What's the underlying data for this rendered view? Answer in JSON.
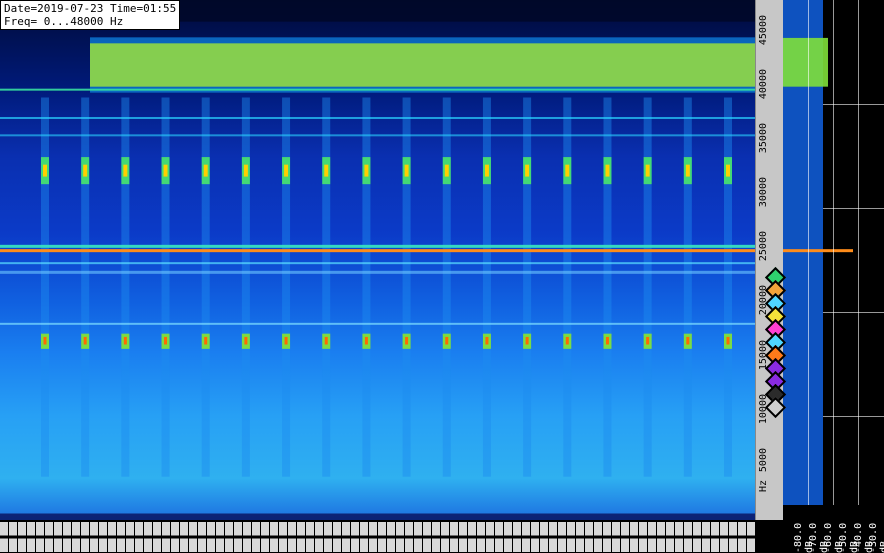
{
  "status": {
    "line1": "Date=2019-07-23 Time=01:55",
    "line2": "Freq= 0...48000 Hz"
  },
  "chart_data": {
    "type": "heatmap",
    "title": "",
    "xlabel": "",
    "ylabel": "Hz",
    "ylim": [
      0,
      48000
    ],
    "y_tick_labels": [
      "45000",
      "40000",
      "35000",
      "30000",
      "25000",
      "20000",
      "15000",
      "10000",
      "5000",
      "Hz"
    ],
    "y_tick_values": [
      45000,
      40000,
      35000,
      30000,
      25000,
      20000,
      15000,
      10000,
      5000,
      0
    ],
    "level_axis_labels": [
      "-80.0 dB",
      "-70.0 dB",
      "-60.0 dB",
      "-50.0 dB",
      "-40.0 dB",
      "-30.0 dB"
    ],
    "level_axis_values": [
      -80,
      -70,
      -60,
      -50,
      -40,
      -30
    ],
    "colors": {
      "background_low": "#001a7a",
      "background_high": "#27a0f5",
      "band_signal": "#9be13c",
      "burst_hot": "#ffd000",
      "carrier_line": "#ff8c1a"
    },
    "pulse_count": 18,
    "carrier_freq_hz": 25000,
    "top_band_hz": [
      40000,
      44000
    ]
  },
  "markers": [
    {
      "color": "#2ed16e"
    },
    {
      "color": "#f2a33a"
    },
    {
      "color": "#4fd6ff"
    },
    {
      "color": "#f5e23a"
    },
    {
      "color": "#ff3fd2"
    },
    {
      "color": "#4fd6ff"
    },
    {
      "color": "#ff7a1a"
    },
    {
      "color": "#8a2be2"
    },
    {
      "color": "#8a2be2"
    },
    {
      "color": "#2b2b2b"
    },
    {
      "color": "#cfcfcf"
    }
  ]
}
